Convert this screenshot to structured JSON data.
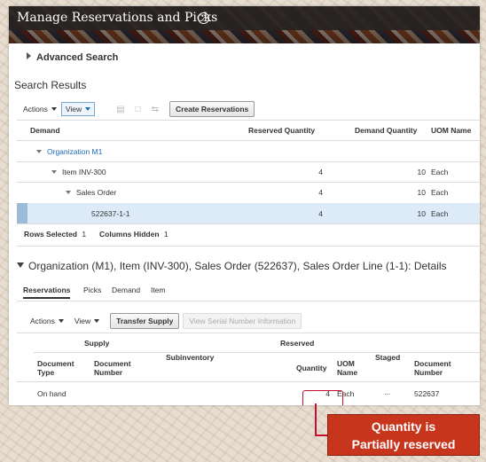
{
  "header": {
    "title": "Manage Reservations and Picks",
    "help_icon": "question-circle-icon"
  },
  "advanced_search": {
    "label": "Advanced Search"
  },
  "search_results": {
    "heading": "Search Results",
    "toolbar": {
      "actions": "Actions",
      "view": "View",
      "create_reservations": "Create Reservations"
    },
    "columns": [
      "Demand",
      "Reserved Quantity",
      "Demand Quantity",
      "UOM Name"
    ],
    "rows": [
      {
        "demand": "Organization M1",
        "reserved": "",
        "demand_qty": "",
        "uom": ""
      },
      {
        "demand": "Item INV-300",
        "reserved": "4",
        "demand_qty": "10",
        "uom": "Each"
      },
      {
        "demand": "Sales Order",
        "reserved": "4",
        "demand_qty": "10",
        "uom": "Each"
      },
      {
        "demand": "522637-1-1",
        "reserved": "4",
        "demand_qty": "10",
        "uom": "Each"
      }
    ],
    "footer": {
      "rows_selected_label": "Rows Selected",
      "rows_selected_value": "1",
      "columns_hidden_label": "Columns Hidden",
      "columns_hidden_value": "1"
    }
  },
  "details": {
    "title": "Organization (M1), Item (INV-300), Sales Order (522637), Sales Order Line (1-1): Details",
    "tabs": [
      "Reservations",
      "Picks",
      "Demand",
      "Item"
    ],
    "toolbar": {
      "actions": "Actions",
      "view": "View",
      "transfer_supply": "Transfer Supply",
      "view_serial": "View Serial Number Information"
    },
    "group_headers": {
      "supply": "Supply",
      "reserved": "Reserved"
    },
    "columns": {
      "document_type": "Document Type",
      "document_number": "Document Number",
      "subinventory": "Subinventory",
      "quantity": "Quantity",
      "uom_name": "UOM Name",
      "staged": "Staged",
      "reserved_document_number": "Document Number"
    },
    "row": {
      "document_type": "On hand",
      "quantity": "4",
      "uom": "Each",
      "staged": "...",
      "document_number": "522637"
    }
  },
  "callout": {
    "line1": "Quantity is",
    "line2": "Partially reserved"
  },
  "colors": {
    "accent": "#1e6bb8",
    "callout_bg": "#c7351d",
    "highlight": "#c8102e",
    "selected_row": "#dcebf7"
  }
}
